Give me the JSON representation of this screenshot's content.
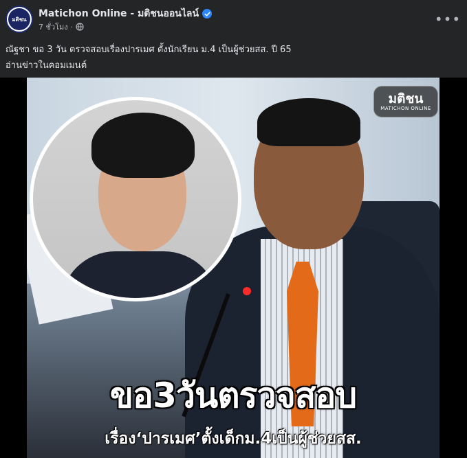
{
  "post": {
    "page_name": "Matichon Online - มติชนออนไลน์",
    "avatar_text": "มติชน",
    "time": "7 ชั่วโมง",
    "meta_separator": "·",
    "more_label": "•••",
    "text_lines": [
      "ณัฐชา ขอ 3 วัน ตรวจสอบเรื่องปารเมศ ตั้งนักเรียน ม.4 เป็นผู้ช่วยสส. ปี 65",
      "อ่านข่าวในคอมเมนต์"
    ]
  },
  "media": {
    "logo_th": "มติชน",
    "logo_en": "MATICHON ONLINE",
    "headline_main": "ขอ3วันตรวจสอบ",
    "headline_sub": "เรื่อง‘ปารเมศ’ตั้งเด็กม.4เป็นผู้ช่วยสส.",
    "accent_tie": "#e26a19",
    "mic_light": "#ff2b2b"
  },
  "icons": {
    "verified": "verified-badge-icon",
    "audience": "globe-icon",
    "more": "more-options-icon"
  },
  "colors": {
    "background": "#242526",
    "text_primary": "#e4e6eb",
    "text_secondary": "#b0b3b8",
    "verified_blue": "#2d88ff"
  }
}
